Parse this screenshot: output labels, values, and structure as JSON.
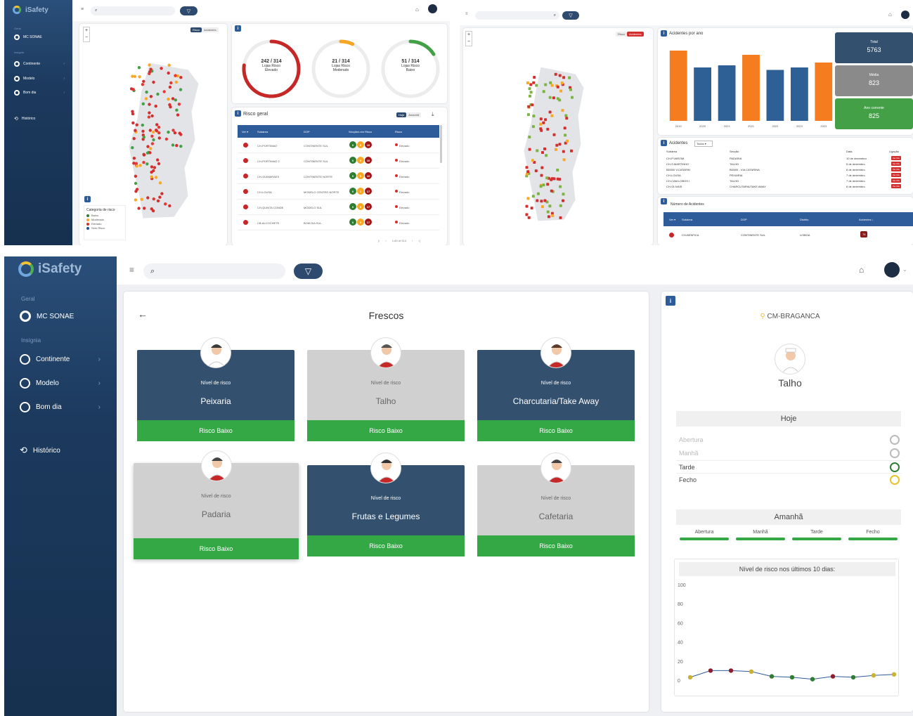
{
  "app": {
    "logo_text": "iSafety",
    "nav": {
      "geral_label": "Geral",
      "mc_sonae": "MC SONAE",
      "insignia_label": "Insígnia",
      "continente": "Continente",
      "modelo": "Modelo",
      "bom_dia": "Bom dia",
      "historico": "Histórico"
    }
  },
  "panel1": {
    "map_toggle": [
      "Risco",
      "Acidentes"
    ],
    "legend": {
      "title": "Categoria de risco",
      "items": [
        {
          "label": "Baixo",
          "color": "#2e7d32"
        },
        {
          "label": "Moderado",
          "color": "#f9a825"
        },
        {
          "label": "Elevado",
          "color": "#d32f2f"
        },
        {
          "label": "Sem Risco",
          "color": "#1e4f9a"
        }
      ]
    },
    "gauges": [
      {
        "count": "242 / 314",
        "line1": "Lojas Risco",
        "line2": "Elevado",
        "color": "#c62828",
        "fraction": 0.77
      },
      {
        "count": "21 / 314",
        "line1": "Lojas Risco",
        "line2": "Moderado",
        "color": "#f5a623",
        "fraction": 0.07
      },
      {
        "count": "51 / 314",
        "line1": "Lojas Risco",
        "line2": "Baixo",
        "color": "#43a047",
        "fraction": 0.16
      }
    ],
    "risk_table": {
      "title": "Risco geral",
      "toggle": [
        "Hoje",
        "Amanhã"
      ],
      "headers": [
        "Ver ▾",
        "Subárea",
        "DOP",
        "Secções em Risco",
        "Risco"
      ],
      "rows": [
        {
          "store": "CH-PORTIMAO",
          "dop": "CONTINENTE SUL",
          "g": "0",
          "y": "0",
          "r": "10",
          "risk": "Elevado"
        },
        {
          "store": "CH-PORTIMAO 2",
          "dop": "CONTINENTE SUL",
          "g": "0",
          "y": "0",
          "r": "10",
          "risk": "Elevado"
        },
        {
          "store": "CH-GUIMARAES",
          "dop": "CONTINENTE NORTE",
          "g": "0",
          "y": "0",
          "r": "10",
          "risk": "Elevado"
        },
        {
          "store": "CH-LOUSA",
          "dop": "MODELO CENTRO NORTE",
          "g": "0",
          "y": "1",
          "r": "17",
          "risk": "Elevado"
        },
        {
          "store": "CH-QUINTA CONDE",
          "dop": "MODELO SUL",
          "g": "0",
          "y": "0",
          "r": "17",
          "risk": "Elevado"
        },
        {
          "store": "CB-ALCOCHETE",
          "dop": "BOM DIA SUL",
          "g": "0",
          "y": "0",
          "r": "17",
          "risk": "Elevado"
        }
      ],
      "pagination": "1-60 of 314"
    }
  },
  "panel2": {
    "map_toggle": [
      "Risco",
      "Acidentes"
    ],
    "chart_title": "Acidentes por ano",
    "chart_data": {
      "type": "bar",
      "categories": [
        "2019",
        "2020",
        "2021",
        "2021",
        "2022",
        "2023",
        "2023"
      ],
      "values": [
        1000,
        760,
        790,
        940,
        725,
        760,
        830
      ],
      "ylim": [
        0,
        1100
      ],
      "colors": [
        "#f57c1f",
        "#2e5f95",
        "#2e5f95",
        "#f57c1f",
        "#2e5f95",
        "#2e5f95",
        "#f57c1f"
      ]
    },
    "stats": [
      {
        "label": "Total",
        "value": "5763",
        "color": "#33506f"
      },
      {
        "label": "Média",
        "value": "823",
        "color": "#8a8a8a"
      },
      {
        "label": "Ano corrente",
        "value": "825",
        "color": "#43a047"
      }
    ],
    "accidents": {
      "title": "Acidentes",
      "filter": "Todos",
      "headers": [
        "Subárea",
        "Secção",
        "Data",
        "Ligação"
      ],
      "rows": [
        {
          "store": "CH-P.VARZIM",
          "section": "PADARIA",
          "date": "10 de dezembro"
        },
        {
          "store": "CH-S.MARTINHO",
          "section": "TALHO",
          "date": "9 de dezembro"
        },
        {
          "store": "BD500 V.CATARIN",
          "section": "BD500 - VIA CATARINA",
          "date": "8 de dezembro"
        },
        {
          "store": "CH-LOUSA",
          "section": "PEIXARIA",
          "date": "7 de dezembro"
        },
        {
          "store": "CH-CAM.LOBOS I",
          "section": "TALHO",
          "date": "7 de dezembro"
        },
        {
          "store": "CH-OLIVAIS",
          "section": "CHARCUTARIA/TAKE AWAY",
          "date": "6 de dezembro"
        }
      ],
      "link_label": "Ver link"
    },
    "num_accidents": {
      "title": "Número de Acidentes",
      "headers": [
        "Ver ▾",
        "Subárea",
        "DOP",
        "Distrito",
        "Acidentes ↓"
      ],
      "row": {
        "store": "CH-BENFICA",
        "dop": "CONTINENTE SUL",
        "district": "LISBOA",
        "count": "78"
      }
    }
  },
  "panel3": {
    "section_title": "Frescos",
    "nivel_label": "Nível de risco",
    "departments": [
      {
        "name": "Peixaria",
        "risk": "Risco Baixo",
        "theme": "dark"
      },
      {
        "name": "Talho",
        "risk": "Risco Baixo",
        "theme": "light"
      },
      {
        "name": "Charcutaria/Take Away",
        "risk": "Risco Baixo",
        "theme": "dark"
      },
      {
        "name": "Padaria",
        "risk": "Risco Baixo",
        "theme": "light"
      },
      {
        "name": "Frutas e Legumes",
        "risk": "Risco Baixo",
        "theme": "dark"
      },
      {
        "name": "Cafetaria",
        "risk": "Risco Baixo",
        "theme": "light"
      }
    ],
    "detail": {
      "store": "CM-BRAGANCA",
      "department": "Talho",
      "hoje_title": "Hoje",
      "hoje_items": [
        {
          "label": "Abertura",
          "state": "empty"
        },
        {
          "label": "Manhã",
          "state": "empty"
        },
        {
          "label": "Tarde",
          "state": "green"
        },
        {
          "label": "Fecho",
          "state": "yellow"
        }
      ],
      "amanha_title": "Amanhã",
      "amanha_items": [
        "Abertura",
        "Manhã",
        "Tarde",
        "Fecho"
      ],
      "chart_title": "Nível de risco nos últimos 10 dias:"
    },
    "chart_data": {
      "type": "line",
      "x": [
        1,
        2,
        3,
        4,
        5,
        6,
        7,
        8,
        9,
        10,
        11
      ],
      "values": [
        3,
        10,
        10,
        9,
        4,
        3,
        1,
        4,
        3,
        5,
        6
      ],
      "point_colors": [
        "#c9b233",
        "#8b1e2f",
        "#8b1e2f",
        "#c9b233",
        "#2e7d32",
        "#2e7d32",
        "#2e7d32",
        "#8b1e2f",
        "#2e7d32",
        "#c9b233",
        "#c9b233"
      ],
      "yticks": [
        0,
        20,
        40,
        60,
        80,
        100
      ],
      "ylim": [
        0,
        100
      ]
    }
  }
}
